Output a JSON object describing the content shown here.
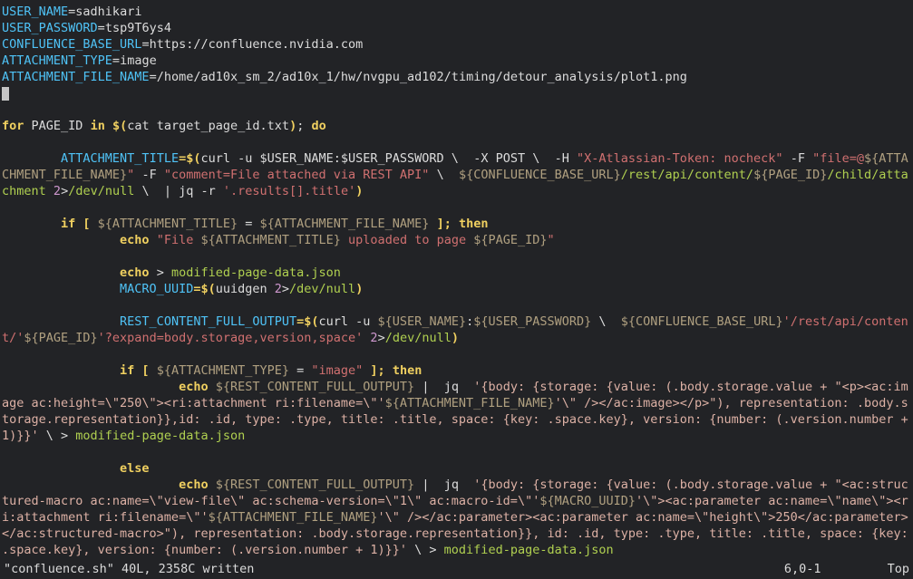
{
  "env": {
    "USER_NAME": "sadhikari",
    "USER_PASSWORD": "tsp9T6ys4",
    "CONFLUENCE_BASE_URL": "https://confluence.nvidia.com",
    "ATTACHMENT_TYPE": "image",
    "ATTACHMENT_FILE_NAME": "/home/ad10x_sm_2/ad10x_1/hw/nvgpu_ad102/timing/detour_analysis/plot1.png"
  },
  "loop": {
    "header_for": "for",
    "header_var": "PAGE_ID",
    "header_in": "in",
    "header_iter_open": "$(",
    "header_iter_cmd": "cat target_page_id.txt",
    "header_iter_close": ")",
    "header_do": "do"
  },
  "curl1": {
    "assign_var": "ATTACHMENT_TITLE",
    "prefix": "=$(",
    "cmd": "curl -u $USER_NAME:$USER_PASSWORD \\  -X POST \\  -H ",
    "hdr": "\"X-Atlassian-Token: nocheck\"",
    "F1a": " -F ",
    "F1b": "\"file=@",
    "F1c": "${ATTACHMENT_FILE_NAME}",
    "F1d": "\"",
    "F2a": " -F ",
    "F2b": "\"comment=File attached via REST API\"",
    "sep": " \\  ",
    "url_open": "${CONFLUENCE_BASE_URL}",
    "url_mid": "/rest/api/content/",
    "url_pid": "${PAGE_ID}",
    "url_end": "/child/attachment",
    "tail_a": " ",
    "tail_num": "2",
    "tail_b": ">",
    "tail_dev": "/dev/null",
    "tail_c": " \\  | jq -r ",
    "jq": "'.results[].title'",
    "close": ")"
  },
  "if1": {
    "open": "if [ ",
    "a": "${ATTACHMENT_TITLE}",
    "eq": " = ",
    "b": "${ATTACHMENT_FILE_NAME}",
    "close": " ]; ",
    "then": "then"
  },
  "echo_upload": {
    "kw": "echo",
    "s1": "\"File ",
    "v1": "${ATTACHMENT_TITLE}",
    "s2": " uploaded to page ",
    "v2": "${PAGE_ID}",
    "s3": "\""
  },
  "echo_clear": {
    "kw": "echo",
    "redir": " > ",
    "target": "modified-page-data.json"
  },
  "uuid": {
    "assign": "MACRO_UUID",
    "open": "=$(",
    "cmd": "uuidgen ",
    "num": "2",
    "gt": ">",
    "dev": "/dev/null",
    "close": ")"
  },
  "curl2": {
    "assign": "REST_CONTENT_FULL_OUTPUT",
    "open": "=$(",
    "cmd1": "curl -u ",
    "u": "${USER_NAME}",
    "colon": ":",
    "p": "${USER_PASSWORD}",
    "sep": " \\  ",
    "base": "${CONFLUENCE_BASE_URL}",
    "path1": "'/rest/api/content/'",
    "pid": "${PAGE_ID}",
    "path2": "'?expand=body.storage,version,space'",
    "tail_sp": " ",
    "tail_num": "2",
    "tail_gt": ">",
    "tail_dev": "/dev/null",
    "close": ")"
  },
  "if2": {
    "open": "if [ ",
    "a": "${ATTACHMENT_TYPE}",
    "eq": " = ",
    "b": "\"image\"",
    "close": " ]; ",
    "then": "then"
  },
  "jq_image": {
    "kw": "echo",
    "v": "${REST_CONTENT_FULL_OUTPUT}",
    "pipe": " |  jq  ",
    "body_a": "'{body: {storage: {value: (.body.storage.value + \"<p><ac:image ac:height=\\\"250\\\"><ri:attachment ri:filename=\\\"'",
    "fname": "${ATTACHMENT_FILE_NAME}",
    "body_b": "'\\\" /></ac:image></p>\"), representation: .body.storage.representation}},id: .id, type: .type, title: .title, space: {key: .space.key}, version: {number: (.version.number + 1)}}' ",
    "redir": "\\ > ",
    "target": "modified-page-data.json"
  },
  "else_kw": "else",
  "jq_file": {
    "kw": "echo",
    "v": "${REST_CONTENT_FULL_OUTPUT}",
    "pipe": " |  jq  ",
    "body_a": "'{body: {storage: {value: (.body.storage.value + \"<ac:structured-macro ac:name=\\\"view-file\\\" ac:schema-version=\\\"1\\\" ac:macro-id=\\\"'",
    "uuid": "${MACRO_UUID}",
    "body_b": "'\\\"><ac:parameter ac:name=\\\"name\\\"><ri:attachment ri:filename=\\\"'",
    "fname": "${ATTACHMENT_FILE_NAME}",
    "body_c": "'\\\" /></ac:parameter><ac:parameter ac:name=\\\"height\\\">250</ac:parameter></ac:structured-macro>\"), representation: .body.storage.representation}}, id: .id, type: .type, title: .title, space: {key: .space.key}, version: {number: (.version.number + 1)}}' ",
    "redir": "\\ > ",
    "target": "modified-page-data.json"
  },
  "status": {
    "left": "\"confluence.sh\" 40L, 2358C written",
    "mid": "6,0-1",
    "right": "Top"
  }
}
